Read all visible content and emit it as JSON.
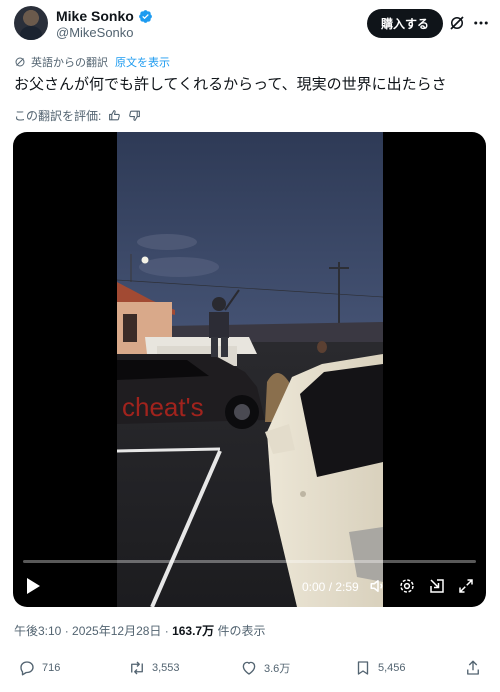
{
  "author": {
    "name": "Mike Sonko",
    "handle": "@MikeSonko",
    "verified": true,
    "avatar_icon": "avatar-photo"
  },
  "header": {
    "buy_label": "購入する",
    "grok_icon": "grok-icon",
    "more_icon": "more-icon"
  },
  "translation": {
    "label": "英語からの翻訳",
    "show_original": "原文を表示",
    "rate_label": "この翻訳を評価:"
  },
  "tweet": {
    "text": "お父さんが何でも許してくれるからって、現実の世界に出たらさ"
  },
  "video": {
    "overlay_text": "cheat's",
    "time": "0:00 / 2:59",
    "progress": 0,
    "icons": [
      "play-icon",
      "volume-icon",
      "settings-icon",
      "pip-icon",
      "fullscreen-icon"
    ]
  },
  "meta": {
    "timestamp": "午後3:10 · 2025年12月28日 · ",
    "views_count": "163.7万",
    "views_label": " 件の表示"
  },
  "actions": {
    "replies": "716",
    "reposts": "3,553",
    "likes": "3.6万",
    "bookmarks": "5,456"
  },
  "colors": {
    "text": "#0f1419",
    "secondary": "#536471",
    "link": "#1d9bf0",
    "button_bg": "#0f1419"
  }
}
